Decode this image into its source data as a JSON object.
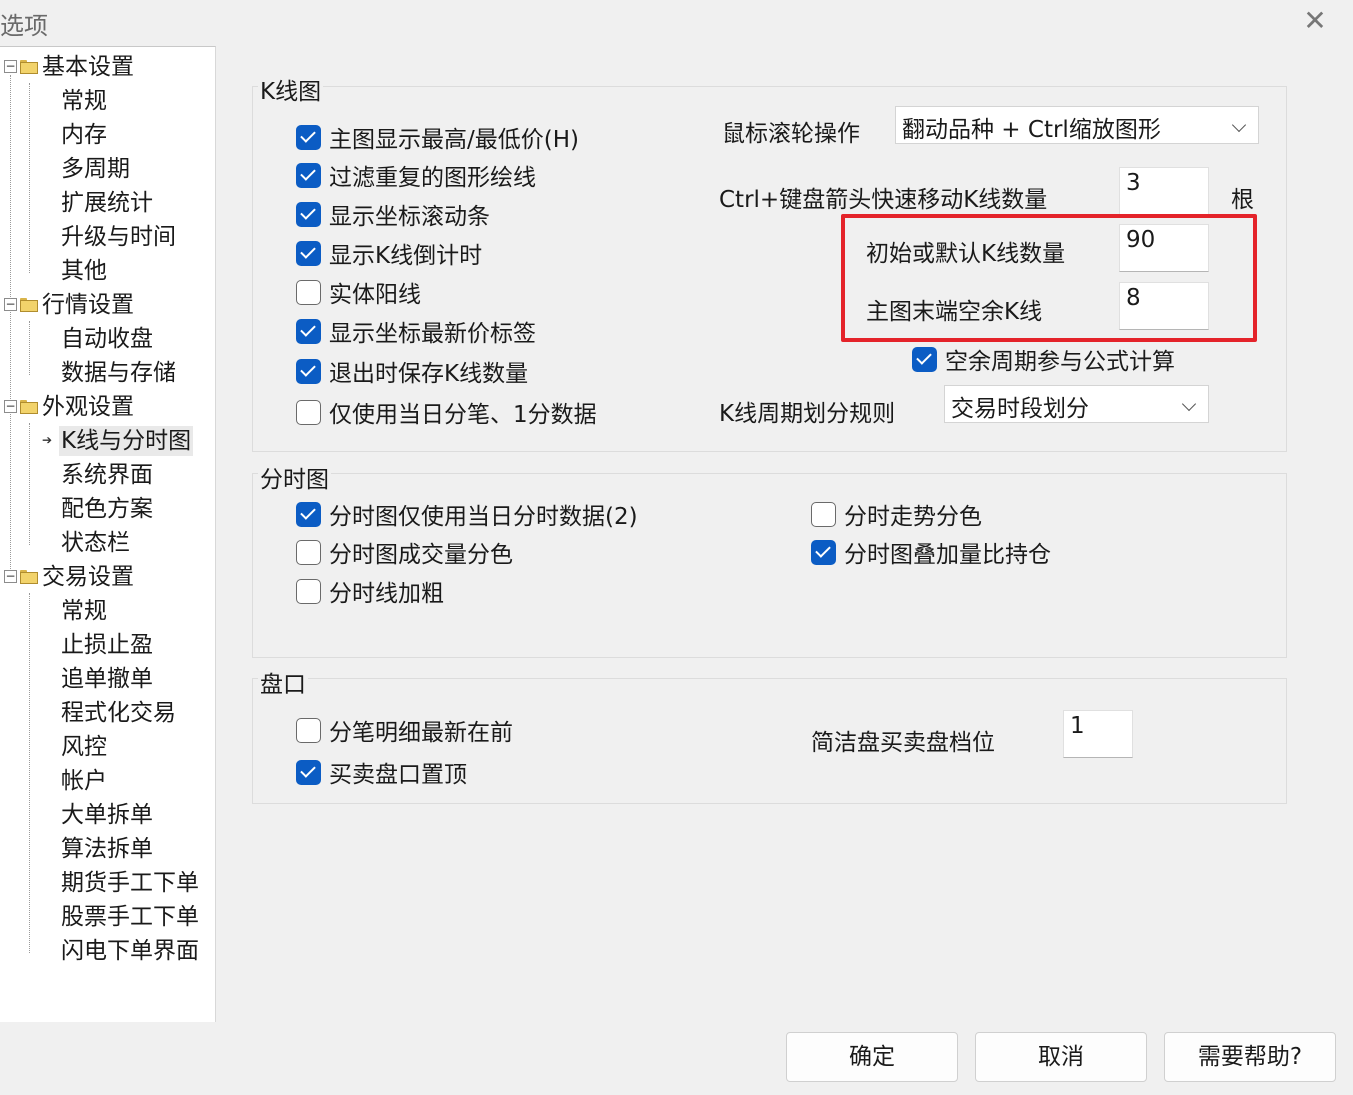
{
  "window": {
    "title": "选项",
    "close_glyph": "✕"
  },
  "tree": {
    "groups": [
      {
        "label": "基本设置",
        "expander": "−",
        "items": [
          "常规",
          "内存",
          "多周期",
          "扩展统计",
          "升级与时间",
          "其他"
        ]
      },
      {
        "label": "行情设置",
        "expander": "−",
        "items": [
          "自动收盘",
          "数据与存储"
        ]
      },
      {
        "label": "外观设置",
        "expander": "−",
        "items": [
          "K线与分时图",
          "系统界面",
          "配色方案",
          "状态栏"
        ],
        "selected": "K线与分时图"
      },
      {
        "label": "交易设置",
        "expander": "−",
        "items": [
          "常规",
          "止损止盈",
          "追单撤单",
          "程式化交易",
          "风控",
          "帐户",
          "大单拆单",
          "算法拆单",
          "期货手工下单",
          "股票手工下单",
          "闪电下单界面"
        ]
      }
    ]
  },
  "kline": {
    "title": "K线图",
    "checkboxes": [
      {
        "label": "主图显示最高/最低价(H)",
        "checked": true
      },
      {
        "label": "过滤重复的图形绘线",
        "checked": true
      },
      {
        "label": "显示坐标滚动条",
        "checked": true
      },
      {
        "label": "显示K线倒计时",
        "checked": true
      },
      {
        "label": "实体阳线",
        "checked": false
      },
      {
        "label": "显示坐标最新价标签",
        "checked": true
      },
      {
        "label": "退出时保存K线数量",
        "checked": true
      },
      {
        "label": "仅使用当日分笔、1分数据",
        "checked": false
      }
    ],
    "wheel_label": "鼠标滚轮操作",
    "wheel_value": "翻动品种 + Ctrl缩放图形",
    "ctrl_label": "Ctrl+键盘箭头快速移动K线数量",
    "ctrl_value": "3",
    "ctrl_unit": "根",
    "initial_label": "初始或默认K线数量",
    "initial_value": "90",
    "tail_label": "主图末端空余K线",
    "tail_value": "8",
    "spare_label": "空余周期参与公式计算",
    "spare_checked": true,
    "rule_label": "K线周期划分规则",
    "rule_value": "交易时段划分"
  },
  "timeshare": {
    "title": "分时图",
    "left": [
      {
        "label": "分时图仅使用当日分时数据(2)",
        "checked": true
      },
      {
        "label": "分时图成交量分色",
        "checked": false
      },
      {
        "label": "分时线加粗",
        "checked": false
      }
    ],
    "right": [
      {
        "label": "分时走势分色",
        "checked": false
      },
      {
        "label": "分时图叠加量比持仓",
        "checked": true
      }
    ]
  },
  "orderbook": {
    "title": "盘口",
    "checkboxes": [
      {
        "label": "分笔明细最新在前",
        "checked": false
      },
      {
        "label": "买卖盘口置顶",
        "checked": true
      }
    ],
    "level_label": "简洁盘买卖盘档位",
    "level_value": "1"
  },
  "buttons": {
    "ok": "确定",
    "cancel": "取消",
    "help": "需要帮助?"
  }
}
